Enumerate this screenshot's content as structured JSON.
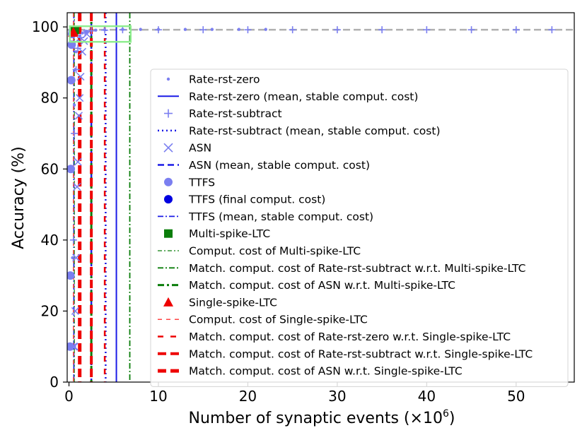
{
  "chart_data": {
    "type": "scatter",
    "xlabel": "Number of synaptic events (×10",
    "xlabel_sup": "6",
    "xlabel_close": ")",
    "ylabel": "Accuracy (%)",
    "xlim": [
      -0.2,
      56.5
    ],
    "ylim": [
      0,
      104
    ],
    "x_ticks": [
      0,
      10,
      20,
      30,
      40,
      50
    ],
    "y_ticks": [
      0,
      20,
      40,
      60,
      80,
      100
    ],
    "grid": false,
    "legend_position": "lower-right",
    "reference_line": {
      "y": 99.2,
      "color": "#b0b0b0",
      "style": "dashed"
    },
    "series": [
      {
        "name": "Rate-rst-zero",
        "marker": "point",
        "color": "#7b7ff0",
        "x": [
          0.3,
          0.4,
          0.5,
          0.6,
          0.7,
          0.8,
          1.0,
          1.2,
          1.5,
          2,
          3,
          4,
          6,
          8,
          10,
          13,
          16,
          19,
          22
        ],
        "y": [
          10,
          35,
          60,
          78,
          88,
          93,
          96,
          97.5,
          98.3,
          98.8,
          99.1,
          99.2,
          99.3,
          99.3,
          99.3,
          99.3,
          99.3,
          99.3,
          99.3
        ]
      },
      {
        "name": "Rate-rst-zero (mean, stable comput. cost)",
        "line": "solid",
        "color": "#1a1ae6",
        "x": 5.3
      },
      {
        "name": "Rate-rst-subtract",
        "marker": "plus",
        "color": "#7b7ff0",
        "x": [
          0.4,
          0.5,
          0.6,
          0.8,
          1.0,
          1.3,
          1.8,
          2.5,
          4,
          6,
          10,
          15,
          20,
          25,
          30,
          35,
          40,
          45,
          50,
          54
        ],
        "y": [
          10,
          40,
          70,
          88,
          94,
          97,
          98.3,
          98.9,
          99.1,
          99.2,
          99.2,
          99.2,
          99.2,
          99.2,
          99.2,
          99.2,
          99.2,
          99.2,
          99.2,
          99.2
        ]
      },
      {
        "name": "Rate-rst-subtract (mean, stable comput. cost)",
        "line": "dotted",
        "color": "#1a1ae6",
        "x": 4.1
      },
      {
        "name": "ASN",
        "marker": "x",
        "color": "#7b7ff0",
        "x": [
          0.5,
          0.6,
          0.7,
          0.8,
          0.9,
          1.0,
          1.1,
          1.2,
          1.3,
          1.5,
          1.7,
          2.0
        ],
        "y": [
          10,
          10,
          20,
          35,
          55,
          62,
          75,
          80,
          86,
          93,
          96,
          98
        ]
      },
      {
        "name": "ASN (mean, stable comput. cost)",
        "line": "dashed",
        "color": "#1a1ae6",
        "x": 2.5
      },
      {
        "name": "TTFS",
        "marker": "circle",
        "color": "#7b7ff0",
        "x": [
          0.1,
          0.15,
          0.2,
          0.25,
          0.3,
          0.35,
          0.4,
          0.5
        ],
        "y": [
          10,
          30,
          60,
          85,
          95,
          98,
          98.8,
          99.1
        ]
      },
      {
        "name": "TTFS (final comput. cost)",
        "marker": "circle",
        "color": "#0000e0",
        "x": [
          0.55
        ],
        "y": [
          99.1
        ]
      },
      {
        "name": "TTFS (mean, stable comput. cost)",
        "line": "dashdot",
        "color": "#1a1ae6",
        "x": 0.55
      },
      {
        "name": "Multi-spike-LTC",
        "marker": "square",
        "color": "#0a7d0a",
        "x": [
          0.55,
          0.6,
          0.65
        ],
        "y": [
          99.0,
          99.1,
          99.2
        ]
      },
      {
        "name": "Comput. cost of Multi-spike-LTC",
        "line": "dashdot-thin",
        "color": "#0a7d0a",
        "x": 0.6
      },
      {
        "name": "Match. comput. cost of Rate-rst-subtract w.r.t. Multi-spike-LTC",
        "line": "dashdot",
        "color": "#0a7d0a",
        "x": 6.8
      },
      {
        "name": "Match. comput. cost of ASN w.r.t. Multi-spike-LTC",
        "line": "dashdot-thick",
        "color": "#0a7d0a",
        "x": 2.5
      },
      {
        "name": "Single-spike-LTC",
        "marker": "triangle",
        "color": "#ee0000",
        "x": [
          0.45,
          0.5
        ],
        "y": [
          98.4,
          98.6
        ]
      },
      {
        "name": "Comput. cost of Single-spike-LTC",
        "line": "dashed-thin",
        "color": "#ff4444",
        "x": 0.5
      },
      {
        "name": "Match. comput. cost of Rate-rst-zero w.r.t. Single-spike-LTC",
        "line": "dashed-med",
        "color": "#ee0000",
        "x": 4.0
      },
      {
        "name": "Match. comput. cost of Rate-rst-subtract w.r.t. Single-spike-LTC",
        "line": "dashed-thick",
        "color": "#ee0000",
        "x": 2.5
      },
      {
        "name": "Match. comput. cost of ASN w.r.t. Single-spike-LTC",
        "line": "dashed-thicker",
        "color": "#ee0000",
        "x": 1.2
      }
    ],
    "inset_box": {
      "x": [
        0.1,
        6.9
      ],
      "y": [
        95.8,
        100.2
      ],
      "color": "#90ee90"
    }
  }
}
